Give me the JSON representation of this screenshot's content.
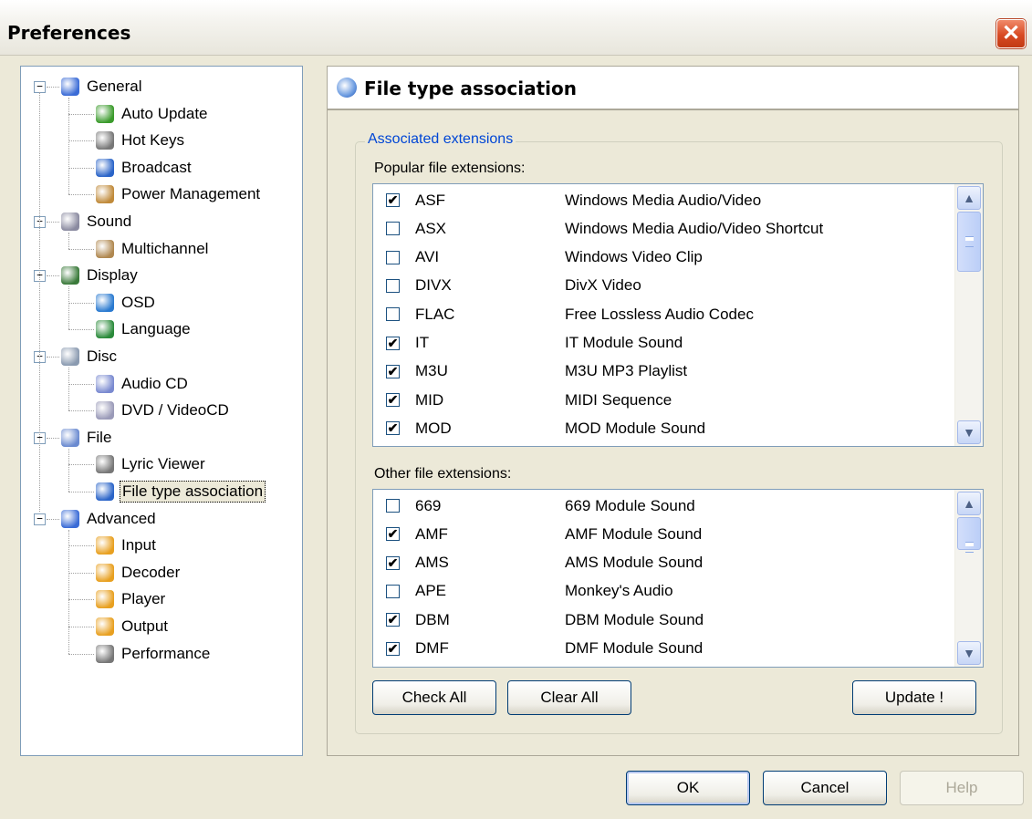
{
  "window": {
    "title": "Preferences",
    "close_glyph": "✕"
  },
  "tree": {
    "items": [
      {
        "label": "General",
        "icon": "general-icon",
        "color": "#3a6bd6"
      },
      {
        "label": "Auto Update",
        "icon": "auto-update-icon",
        "color": "#3b9b2c"
      },
      {
        "label": "Hot Keys",
        "icon": "keyboard-icon",
        "color": "#777777"
      },
      {
        "label": "Broadcast",
        "icon": "broadcast-icon",
        "color": "#2a64c8"
      },
      {
        "label": "Power Management",
        "icon": "power-icon",
        "color": "#c08a3a"
      },
      {
        "label": "Sound",
        "icon": "sound-icon",
        "color": "#8a8aa0"
      },
      {
        "label": "Multichannel",
        "icon": "multichannel-icon",
        "color": "#b08850"
      },
      {
        "label": "Display",
        "icon": "display-icon",
        "color": "#3a7a3a"
      },
      {
        "label": "OSD",
        "icon": "osd-icon",
        "color": "#2a7ad0"
      },
      {
        "label": "Language",
        "icon": "globe-icon",
        "color": "#2a8a3a"
      },
      {
        "label": "Disc",
        "icon": "disc-icon",
        "color": "#8a9ab0"
      },
      {
        "label": "Audio CD",
        "icon": "audio-cd-icon",
        "color": "#7a8ad0"
      },
      {
        "label": "DVD / VideoCD",
        "icon": "dvd-icon",
        "color": "#9a9ab8"
      },
      {
        "label": "File",
        "icon": "file-icon",
        "color": "#6a8ad0"
      },
      {
        "label": "Lyric Viewer",
        "icon": "microphone-icon",
        "color": "#777777"
      },
      {
        "label": "File type association",
        "icon": "file-type-icon",
        "color": "#2a64c8"
      },
      {
        "label": "Advanced",
        "icon": "advanced-icon",
        "color": "#3a6bd6"
      },
      {
        "label": "Input",
        "icon": "input-icon",
        "color": "#e8a020"
      },
      {
        "label": "Decoder",
        "icon": "decoder-icon",
        "color": "#e8a020"
      },
      {
        "label": "Player",
        "icon": "player-icon",
        "color": "#e8a020"
      },
      {
        "label": "Output",
        "icon": "output-icon",
        "color": "#e8a020"
      },
      {
        "label": "Performance",
        "icon": "chip-icon",
        "color": "#777777"
      }
    ],
    "expander_glyph": "−"
  },
  "panel": {
    "title": "File type association",
    "group_label": "Associated extensions",
    "popular_label": "Popular file extensions:",
    "other_label": "Other file extensions:",
    "popular": [
      {
        "ext": "ASF",
        "desc": "Windows Media Audio/Video",
        "checked": true
      },
      {
        "ext": "ASX",
        "desc": "Windows Media Audio/Video Shortcut",
        "checked": false
      },
      {
        "ext": "AVI",
        "desc": "Windows Video Clip",
        "checked": false
      },
      {
        "ext": "DIVX",
        "desc": "DivX Video",
        "checked": false
      },
      {
        "ext": "FLAC",
        "desc": "Free Lossless Audio Codec",
        "checked": false
      },
      {
        "ext": "IT",
        "desc": "IT Module Sound",
        "checked": true
      },
      {
        "ext": "M3U",
        "desc": "M3U MP3 Playlist",
        "checked": true
      },
      {
        "ext": "MID",
        "desc": "MIDI Sequence",
        "checked": true
      },
      {
        "ext": "MOD",
        "desc": "MOD Module Sound",
        "checked": true
      }
    ],
    "other": [
      {
        "ext": "669",
        "desc": "669 Module Sound",
        "checked": false
      },
      {
        "ext": "AMF",
        "desc": "AMF Module Sound",
        "checked": true
      },
      {
        "ext": "AMS",
        "desc": "AMS Module Sound",
        "checked": true
      },
      {
        "ext": "APE",
        "desc": "Monkey's Audio",
        "checked": false
      },
      {
        "ext": "DBM",
        "desc": "DBM Module Sound",
        "checked": true
      },
      {
        "ext": "DMF",
        "desc": "DMF Module Sound",
        "checked": true
      }
    ],
    "check_all": "Check All",
    "clear_all": "Clear All",
    "update": "Update !",
    "scroll_up": "▲",
    "scroll_down": "▼"
  },
  "footer": {
    "ok": "OK",
    "cancel": "Cancel",
    "help": "Help"
  }
}
